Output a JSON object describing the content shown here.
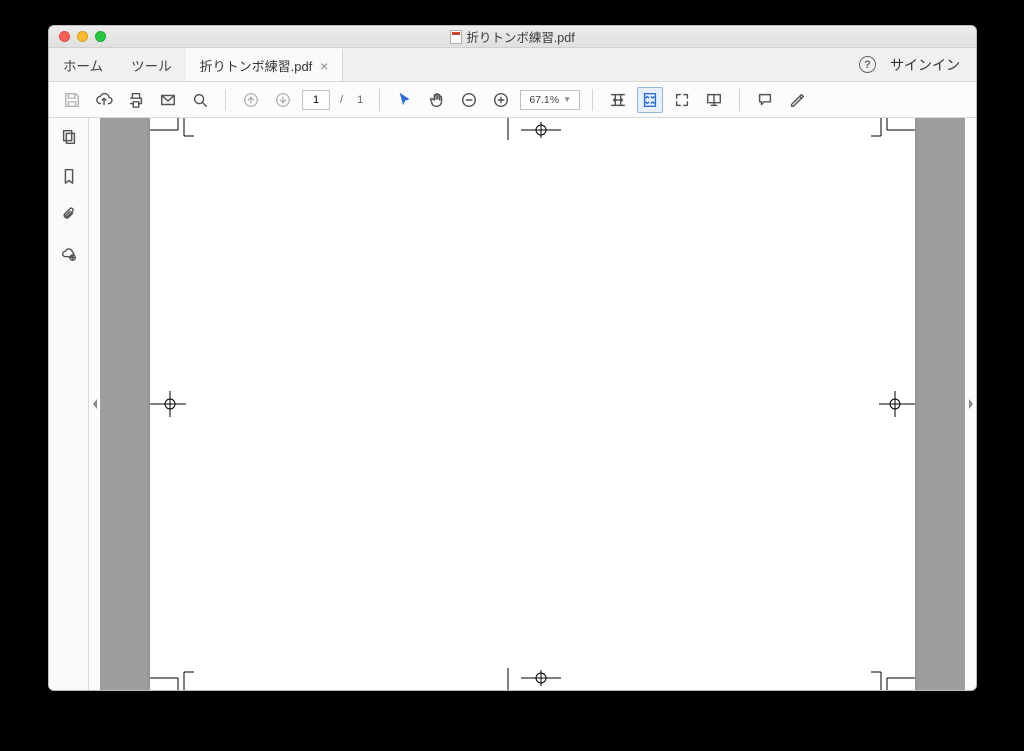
{
  "window": {
    "title": "折りトンボ練習.pdf"
  },
  "tabs": {
    "home": "ホーム",
    "tools": "ツール",
    "doc": "折りトンボ練習.pdf",
    "signin": "サインイン"
  },
  "toolbar": {
    "page_current": "1",
    "page_sep": "/",
    "page_total": "1",
    "zoom": "67.1%"
  }
}
